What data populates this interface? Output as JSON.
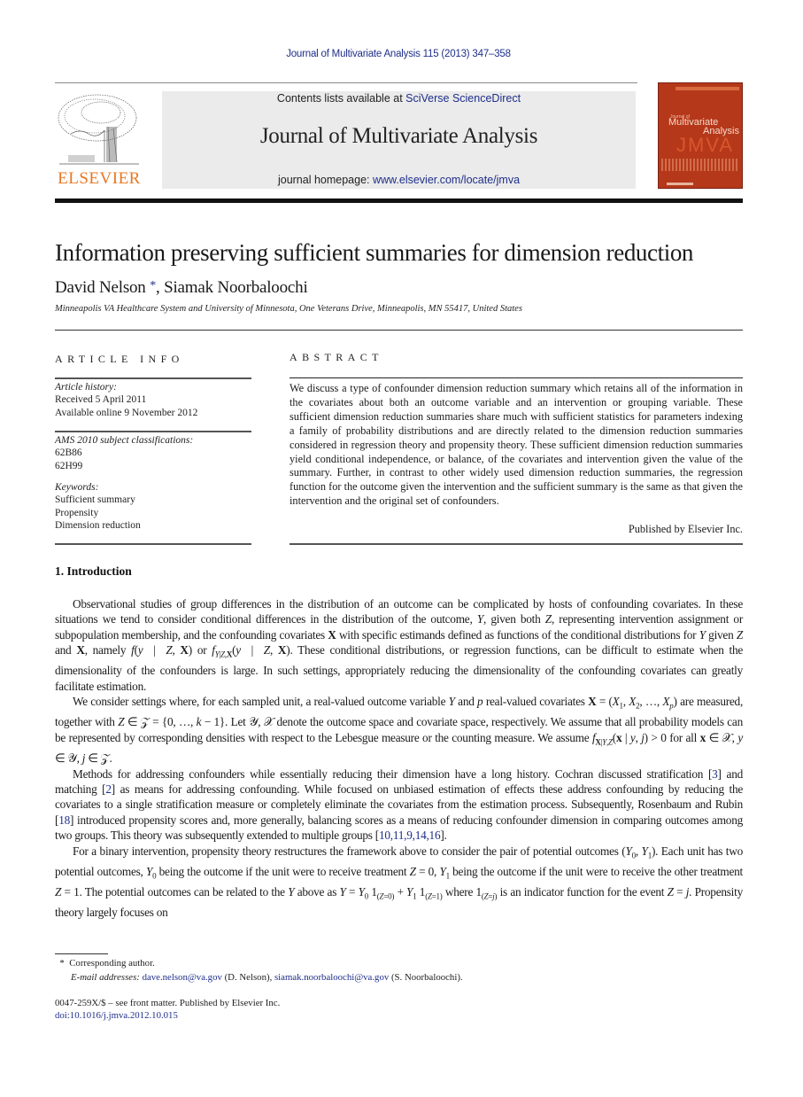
{
  "running_head": "Journal of Multivariate Analysis 115 (2013) 347–358",
  "banner": {
    "contents_prefix": "Contents lists available at ",
    "contents_link": "SciVerse ScienceDirect",
    "journal_title": "Journal of Multivariate Analysis",
    "homepage_prefix": "journal homepage: ",
    "homepage_link": "www.elsevier.com/locate/jmva"
  },
  "publisher_logo": {
    "text": "ELSEVIER",
    "color": "#e87722"
  },
  "cover": {
    "small": "Journal of",
    "line1": "Multivariate",
    "line2": "Analysis",
    "abbrev": "JMVA",
    "color": "#b5381a"
  },
  "article": {
    "title": "Information preserving sufficient summaries for dimension reduction",
    "authors": [
      {
        "name": "David Nelson",
        "mark": "*"
      },
      {
        "name": "Siamak Noorbaloochi",
        "mark": ""
      }
    ],
    "author_sep": ", ",
    "affiliation": "Minneapolis VA Healthcare System and University of Minnesota, One Veterans Drive, Minneapolis, MN 55417, United States"
  },
  "article_info": {
    "heading": "ARTICLE INFO",
    "history_label": "Article history:",
    "received": "Received 5 April 2011",
    "available": "Available online 9 November 2012",
    "ams_label": "AMS 2010 subject classifications:",
    "ams_codes": [
      "62B86",
      "62H99"
    ],
    "keywords_label": "Keywords:",
    "keywords": [
      "Sufficient summary",
      "Propensity",
      "Dimension reduction"
    ]
  },
  "abstract": {
    "heading": "ABSTRACT",
    "text": "We discuss a type of confounder dimension reduction summary which retains all of the information in the covariates about both an outcome variable and an intervention or grouping variable. These sufficient dimension reduction summaries share much with sufficient statistics for parameters indexing a family of probability distributions and are directly related to the dimension reduction summaries considered in regression theory and propensity theory. These sufficient dimension reduction summaries yield conditional independence, or balance, of the covariates and intervention given the value of the summary. Further, in contrast to other widely used dimension reduction summaries, the regression function for the outcome given the intervention and the sufficient summary is the same as that given the intervention and the original set of confounders.",
    "published": "Published by Elsevier Inc."
  },
  "section1": {
    "heading": "1.  Introduction",
    "p1": {
      "a": "Observational studies of group differences in the distribution of an outcome can be complicated by hosts of confounding covariates. In these situations we tend to consider conditional differences in the distribution of the outcome, ",
      "b": ", given both ",
      "c": ", representing intervention assignment or subpopulation membership, and the confounding covariates ",
      "d": " with specific estimands defined as functions of the conditional distributions for ",
      "e": " given ",
      "f": " and ",
      "g": ", namely ",
      "h": " or ",
      "i": ". These conditional distributions, or regression functions, can be difficult to estimate when the dimensionality of the confounders is large. In such settings, appropriately reducing the dimensionality of the confounding covariates can greatly facilitate estimation."
    },
    "p2": {
      "a": "We consider settings where, for each sampled unit, a real-valued outcome variable ",
      "b": " and ",
      "c": " real-valued covariates ",
      "d": " are measured, together with ",
      "e": ". Let ",
      "f": " denote the outcome space and covariate space, respectively. We assume that all probability models can be represented by corresponding densities with respect to the Lebesgue measure or the counting measure. We assume ",
      "g": " for all "
    },
    "p3": {
      "a": "Methods for addressing confounders while essentially reducing their dimension have a long history. Cochran discussed stratification [",
      "ref1": "3",
      "b": "] and matching [",
      "ref2": "2",
      "c": "] as means for addressing confounding. While focused on unbiased estimation of effects these address confounding by reducing the covariates to a single stratification measure or completely eliminate the covariates from the estimation process. Subsequently, Rosenbaum and Rubin [",
      "ref3": "18",
      "d": "] introduced propensity scores and, more generally, balancing scores as a means of reducing confounder dimension in comparing outcomes among two groups. This theory was subsequently extended to multiple groups [",
      "ref4": "10,11,9,14,16",
      "e": "]."
    },
    "p4": {
      "a": "For a binary intervention, propensity theory restructures the framework above to consider the pair of potential outcomes ",
      "b": ". Each unit has two potential outcomes, ",
      "c": " being the outcome if the unit were to receive treatment ",
      "d": " being the outcome if the unit were to receive the other treatment ",
      "e": ". The potential outcomes can be related to the ",
      "f": " above as ",
      "g": " where ",
      "h": " is an indicator function for the event ",
      "i": ". Propensity theory largely focuses on"
    }
  },
  "footnotes": {
    "star": "*",
    "corresponding": "Corresponding author.",
    "email_label": "E-mail addresses: ",
    "email1": "dave.nelson@va.gov",
    "email1_name": " (D. Nelson), ",
    "email2": "siamak.noorbaloochi@va.gov",
    "email2_name": " (S. Noorbaloochi).",
    "issn": "0047-259X/$ – see front matter.  Published by Elsevier Inc.",
    "doi": "doi:10.1016/j.jmva.2012.10.015"
  }
}
